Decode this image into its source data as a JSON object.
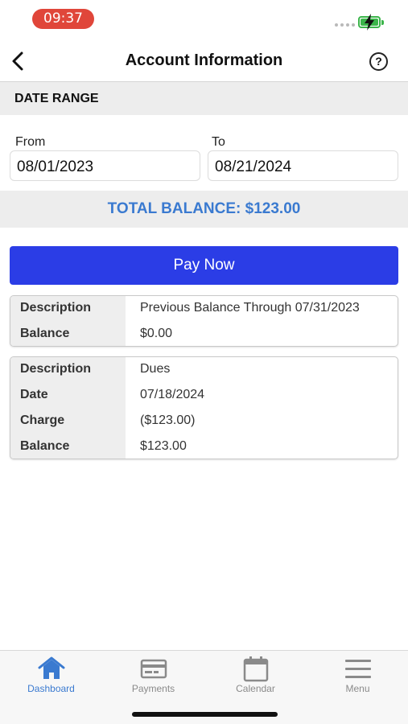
{
  "status_bar": {
    "time": "09:37",
    "time_pill_color": "#e0463a",
    "battery_color": "#3bb54a",
    "icons": [
      "signal-dots-icon",
      "battery-charging-icon"
    ]
  },
  "nav": {
    "title": "Account Information",
    "back_icon": "chevron-left-icon",
    "help_label": "?"
  },
  "date_range": {
    "header": "DATE RANGE",
    "from_label": "From",
    "from_value": "08/01/2023",
    "to_label": "To",
    "to_value": "08/21/2024"
  },
  "total_balance": {
    "text": "TOTAL BALANCE: $123.00",
    "color": "#3a7ad0"
  },
  "pay_button": {
    "label": "Pay Now",
    "color": "#2b3de6"
  },
  "records": [
    {
      "rows": [
        {
          "label": "Description",
          "value": "Previous Balance Through 07/31/2023"
        },
        {
          "label": "Balance",
          "value": "$0.00"
        }
      ]
    },
    {
      "rows": [
        {
          "label": "Description",
          "value": "Dues"
        },
        {
          "label": "Date",
          "value": "07/18/2024"
        },
        {
          "label": "Charge",
          "value": "($123.00)"
        },
        {
          "label": "Balance",
          "value": "$123.00"
        }
      ]
    }
  ],
  "tabs": [
    {
      "label": "Dashboard",
      "icon": "home-icon",
      "active": true
    },
    {
      "label": "Payments",
      "icon": "credit-card-icon",
      "active": false
    },
    {
      "label": "Calendar",
      "icon": "calendar-icon",
      "active": false
    },
    {
      "label": "Menu",
      "icon": "hamburger-menu-icon",
      "active": false
    }
  ]
}
